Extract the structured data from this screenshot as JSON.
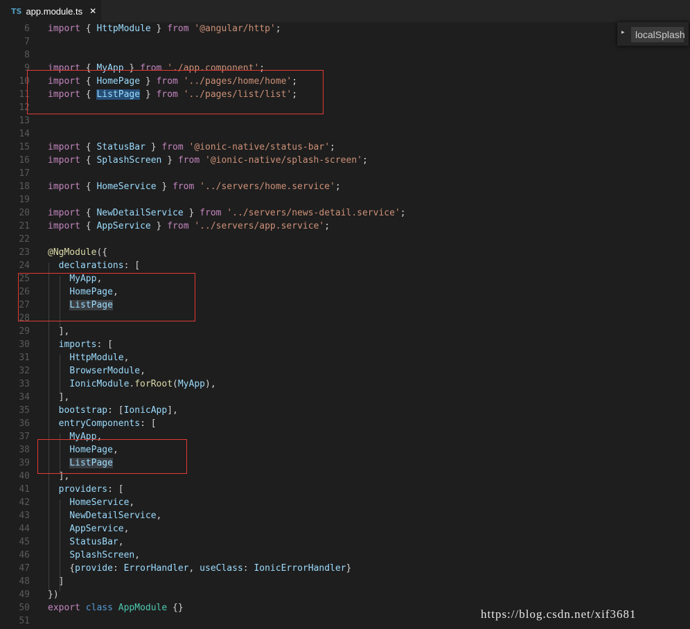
{
  "tab": {
    "icon": "TS",
    "filename": "app.module.ts",
    "close_icon": "✕"
  },
  "outline": {
    "toggle_icon": "▸",
    "label": "localSplash"
  },
  "watermark": "https://blog.csdn.net/xif3681",
  "lines": [
    {
      "n": "6",
      "code": "import { HttpModule } from '@angular/http';"
    },
    {
      "n": "7",
      "code": ""
    },
    {
      "n": "8",
      "code": ""
    },
    {
      "n": "9",
      "code": "import { MyApp } from './app.component';"
    },
    {
      "n": "10",
      "code": "import { HomePage } from '../pages/home/home';"
    },
    {
      "n": "11",
      "code": "import { ListPage } from '../pages/list/list';"
    },
    {
      "n": "12",
      "code": ""
    },
    {
      "n": "13",
      "code": ""
    },
    {
      "n": "14",
      "code": ""
    },
    {
      "n": "15",
      "code": "import { StatusBar } from '@ionic-native/status-bar';"
    },
    {
      "n": "16",
      "code": "import { SplashScreen } from '@ionic-native/splash-screen';"
    },
    {
      "n": "17",
      "code": ""
    },
    {
      "n": "18",
      "code": "import { HomeService } from '../servers/home.service';"
    },
    {
      "n": "19",
      "code": ""
    },
    {
      "n": "20",
      "code": "import { NewDetailService } from '../servers/news-detail.service';"
    },
    {
      "n": "21",
      "code": "import { AppService } from '../servers/app.service';"
    },
    {
      "n": "22",
      "code": ""
    },
    {
      "n": "23",
      "code": "@NgModule({"
    },
    {
      "n": "24",
      "code": "  declarations: ["
    },
    {
      "n": "25",
      "code": "    MyApp,"
    },
    {
      "n": "26",
      "code": "    HomePage,"
    },
    {
      "n": "27",
      "code": "    ListPage"
    },
    {
      "n": "28",
      "code": ""
    },
    {
      "n": "29",
      "code": "  ],"
    },
    {
      "n": "30",
      "code": "  imports: ["
    },
    {
      "n": "31",
      "code": "    HttpModule,"
    },
    {
      "n": "32",
      "code": "    BrowserModule,"
    },
    {
      "n": "33",
      "code": "    IonicModule.forRoot(MyApp),"
    },
    {
      "n": "34",
      "code": "  ],"
    },
    {
      "n": "35",
      "code": "  bootstrap: [IonicApp],"
    },
    {
      "n": "36",
      "code": "  entryComponents: ["
    },
    {
      "n": "37",
      "code": "    MyApp,"
    },
    {
      "n": "38",
      "code": "    HomePage,"
    },
    {
      "n": "39",
      "code": "    ListPage"
    },
    {
      "n": "40",
      "code": "  ],"
    },
    {
      "n": "41",
      "code": "  providers: ["
    },
    {
      "n": "42",
      "code": "    HomeService,"
    },
    {
      "n": "43",
      "code": "    NewDetailService,"
    },
    {
      "n": "44",
      "code": "    AppService,"
    },
    {
      "n": "45",
      "code": "    StatusBar,"
    },
    {
      "n": "46",
      "code": "    SplashScreen,"
    },
    {
      "n": "47",
      "code": "    {provide: ErrorHandler, useClass: IonicErrorHandler}"
    },
    {
      "n": "48",
      "code": "  ]"
    },
    {
      "n": "49",
      "code": "})"
    },
    {
      "n": "50",
      "code": "export class AppModule {}"
    },
    {
      "n": "51",
      "code": ""
    }
  ]
}
